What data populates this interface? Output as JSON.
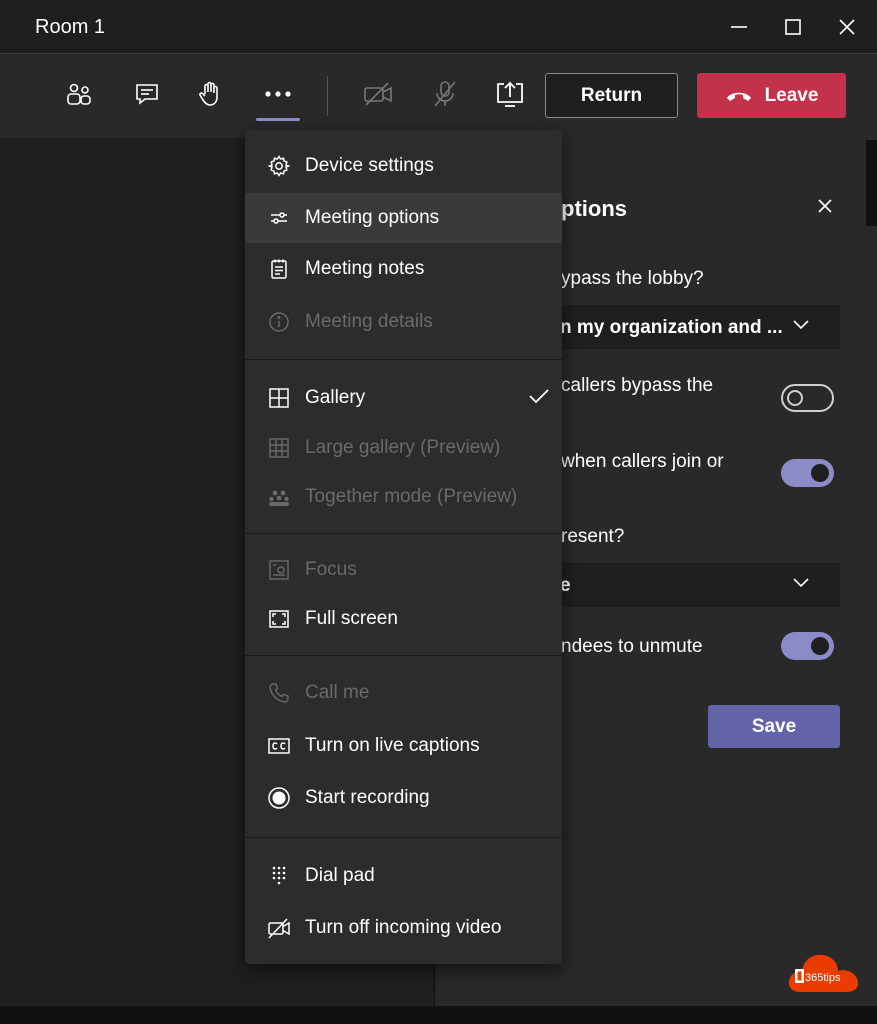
{
  "window": {
    "title": "Room 1"
  },
  "toolbar": {
    "return_label": "Return",
    "leave_label": "Leave"
  },
  "menu": {
    "items": [
      {
        "label": "Device settings",
        "icon": "gear-icon",
        "disabled": false
      },
      {
        "label": "Meeting options",
        "icon": "sliders-icon",
        "disabled": false,
        "selected": true
      },
      {
        "label": "Meeting notes",
        "icon": "notes-icon",
        "disabled": false
      },
      {
        "label": "Meeting details",
        "icon": "info-icon",
        "disabled": true
      },
      {
        "label": "Gallery",
        "icon": "gallery-icon",
        "disabled": false,
        "checked": true
      },
      {
        "label": "Large gallery (Preview)",
        "icon": "large-gallery-icon",
        "disabled": true
      },
      {
        "label": "Together mode (Preview)",
        "icon": "together-mode-icon",
        "disabled": true
      },
      {
        "label": "Focus",
        "icon": "focus-icon",
        "disabled": true
      },
      {
        "label": "Full screen",
        "icon": "fullscreen-icon",
        "disabled": false
      },
      {
        "label": "Call me",
        "icon": "phone-icon",
        "disabled": true
      },
      {
        "label": "Turn on live captions",
        "icon": "captions-icon",
        "disabled": false
      },
      {
        "label": "Start recording",
        "icon": "record-icon",
        "disabled": false
      },
      {
        "label": "Dial pad",
        "icon": "dialpad-icon",
        "disabled": false
      },
      {
        "label": "Turn off incoming video",
        "icon": "video-off-icon",
        "disabled": false
      }
    ]
  },
  "options_panel": {
    "title": "ptions",
    "lobby_question": "ypass the lobby?",
    "lobby_value": "n my organization and ...",
    "callers_bypass": "callers bypass the",
    "callers_bypass_on": false,
    "announce": "when callers join or",
    "announce_on": true,
    "present_question": "resent?",
    "present_value": "e",
    "unmute": "ndees to unmute",
    "unmute_on": true,
    "save_label": "Save"
  },
  "logo": {
    "text": "365tips"
  },
  "colors": {
    "accent": "#6264a7",
    "toggle_on": "#8b8cc7",
    "leave": "#c4314b",
    "logo": "#eb3c00"
  }
}
